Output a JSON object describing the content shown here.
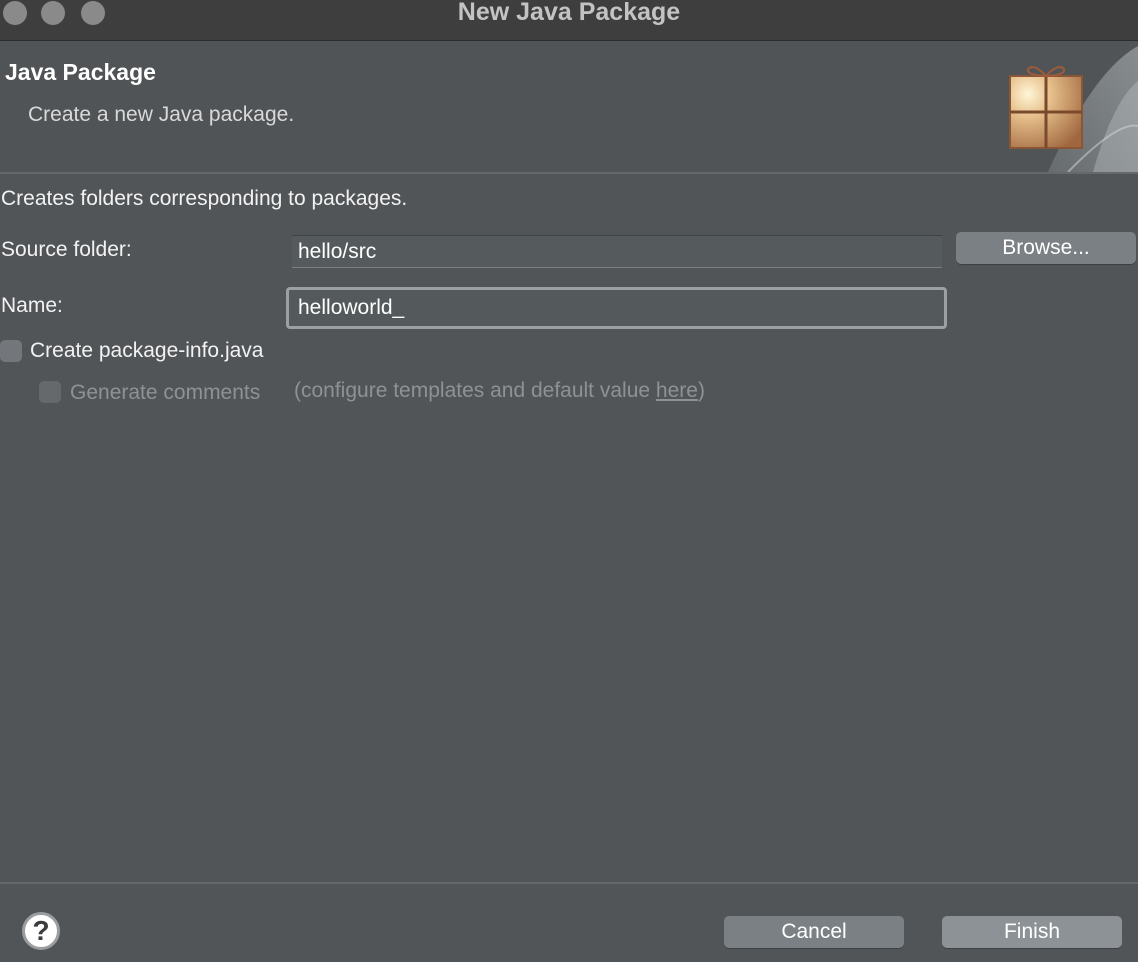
{
  "window": {
    "title": "New Java Package"
  },
  "banner": {
    "title": "Java Package",
    "description": "Create a new Java package."
  },
  "form": {
    "intro": "Creates folders corresponding to packages.",
    "source_folder_label": "Source folder:",
    "source_folder_value": "hello/src",
    "browse_label": "Browse...",
    "name_label": "Name:",
    "name_value": "helloworld_",
    "package_info_label": "Create package-info.java",
    "package_info_checked": false,
    "generate_comments_label": "Generate comments",
    "generate_comments_checked": false,
    "generate_comments_enabled": false,
    "config_prefix": "(configure templates and default value ",
    "config_link": "here",
    "config_suffix": ")"
  },
  "footer": {
    "help_symbol": "?",
    "cancel_label": "Cancel",
    "finish_label": "Finish"
  },
  "icons": {
    "help": "help-icon",
    "package": "package-icon"
  },
  "colors": {
    "background": "#515558",
    "titlebar": "#3e3e3e",
    "button": "#7b8084",
    "text": "#f2f2f2",
    "disabled_text": "#8e9296"
  }
}
